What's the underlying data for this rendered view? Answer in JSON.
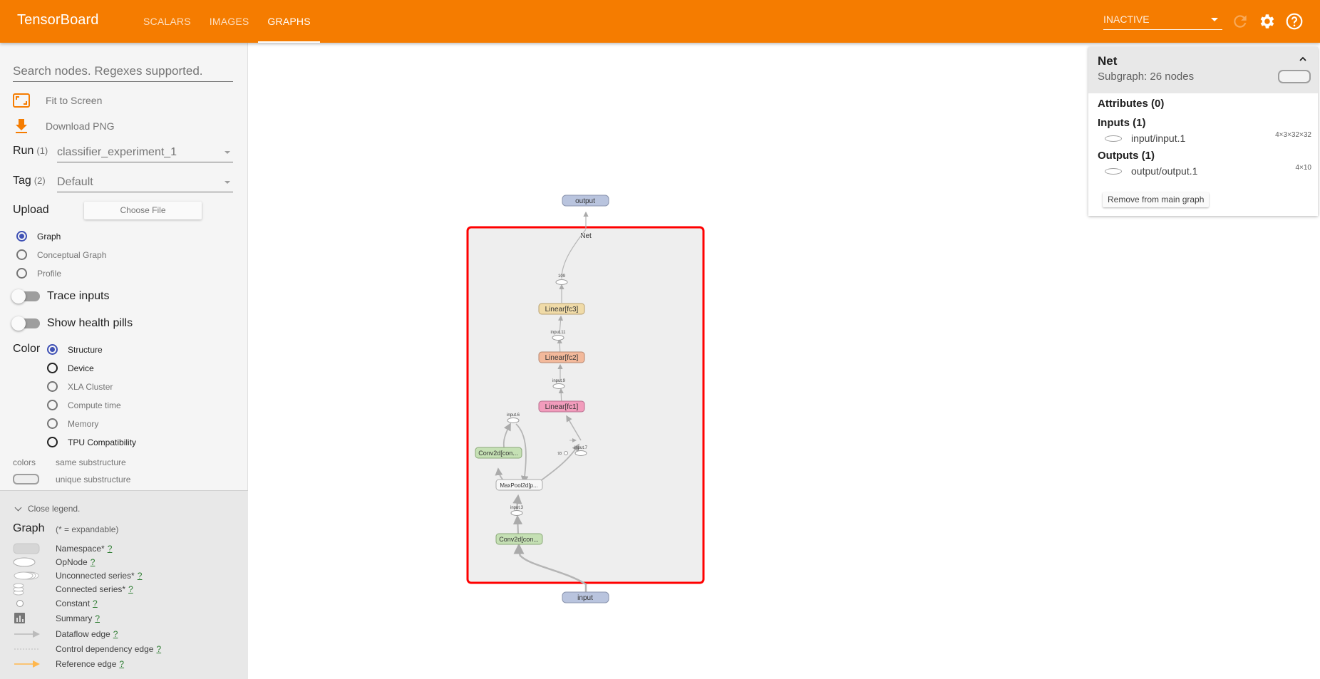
{
  "header": {
    "brand": "TensorBoard",
    "tabs": [
      {
        "label": "SCALARS",
        "active": false
      },
      {
        "label": "IMAGES",
        "active": false
      },
      {
        "label": "GRAPHS",
        "active": true
      }
    ],
    "status_select": "INACTIVE",
    "icons": [
      "refresh-icon",
      "settings-gear-icon",
      "help-icon"
    ],
    "accent_color": "#f57c00"
  },
  "sidebar": {
    "search_placeholder": "Search nodes. Regexes supported.",
    "fit_to_screen": "Fit to Screen",
    "download_png": "Download PNG",
    "run_label": "Run",
    "run_count": "(1)",
    "run_value": "classifier_experiment_1",
    "tag_label": "Tag",
    "tag_count": "(2)",
    "tag_value": "Default",
    "upload_label": "Upload",
    "choose_file": "Choose File",
    "graph_types": [
      {
        "label": "Graph",
        "selected": true
      },
      {
        "label": "Conceptual Graph",
        "selected": false
      },
      {
        "label": "Profile",
        "selected": false
      }
    ],
    "trace_inputs": {
      "label": "Trace inputs",
      "on": false
    },
    "health_pills": {
      "label": "Show health pills",
      "on": false
    },
    "color_label": "Color",
    "color_options": [
      {
        "label": "Structure",
        "selected": true
      },
      {
        "label": "Device",
        "selected": false
      },
      {
        "label": "XLA Cluster",
        "selected": false
      },
      {
        "label": "Compute time",
        "selected": false
      },
      {
        "label": "Memory",
        "selected": false
      },
      {
        "label": "TPU Compatibility",
        "selected": false
      }
    ],
    "colors_key": "colors",
    "same_substructure": "same substructure",
    "unique_substructure": "unique substructure"
  },
  "legend": {
    "close": "Close legend.",
    "title": "Graph",
    "subtitle": "(* = expandable)",
    "items": [
      {
        "label": "Namespace*",
        "q": "?"
      },
      {
        "label": "OpNode",
        "q": "?"
      },
      {
        "label": "Unconnected series*",
        "q": "?"
      },
      {
        "label": "Connected series*",
        "q": "?"
      },
      {
        "label": "Constant",
        "q": "?"
      },
      {
        "label": "Summary",
        "q": "?"
      },
      {
        "label": "Dataflow edge",
        "q": "?"
      },
      {
        "label": "Control dependency edge",
        "q": "?"
      },
      {
        "label": "Reference edge",
        "q": "?"
      }
    ]
  },
  "graph": {
    "namespace_label": "Net",
    "selection_color": "#ff0000",
    "nodes": {
      "output": "output",
      "input": "input",
      "n109": "109",
      "fc3": "Linear[fc3]",
      "input11": "input.11",
      "fc2": "Linear[fc2]",
      "input9": "input.9",
      "fc1": "Linear[fc1]",
      "input6": "input.6",
      "conv_top": "Conv2d[con...",
      "input7": "input.7",
      "const93": "93",
      "maxpool": "MaxPool2d[p...",
      "input3": "input.3",
      "conv_bottom": "Conv2d[con..."
    },
    "colors": {
      "io": "#b9c4de",
      "fc3": "#f0dba8",
      "fc2": "#f3b99b",
      "fc1": "#f29cbc",
      "conv": "#c5e0b4",
      "maxpool": "#f7f7f7"
    }
  },
  "info_card": {
    "title": "Net",
    "subtitle": "Subgraph: 26 nodes",
    "attributes": "Attributes (0)",
    "inputs_title": "Inputs (1)",
    "inputs": [
      {
        "name": "input/input.1",
        "shape": "4×3×32×32"
      }
    ],
    "outputs_title": "Outputs (1)",
    "outputs": [
      {
        "name": "output/output.1",
        "shape": "4×10"
      }
    ],
    "remove_button": "Remove from main graph"
  }
}
